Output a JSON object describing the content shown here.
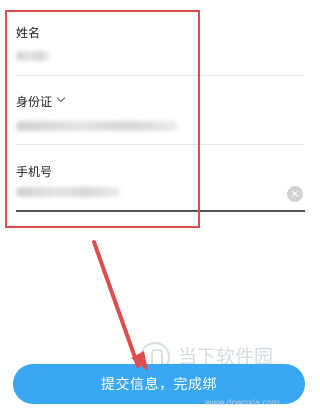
{
  "form": {
    "name": {
      "label": "姓名"
    },
    "id": {
      "label": "身份证"
    },
    "phone": {
      "label": "手机号"
    }
  },
  "submit_label": "提交信息，完成绑",
  "watermark": {
    "name": "当下软件园",
    "url": "www.downxia.com"
  },
  "icons": {
    "clear": "clear-icon",
    "dropdown": "chevron-down-icon",
    "watermark_logo": "watermark-logo-icon"
  },
  "colors": {
    "accent": "#3aa7f5",
    "highlight": "#e04b4b",
    "arrow": "#e04b4b"
  }
}
